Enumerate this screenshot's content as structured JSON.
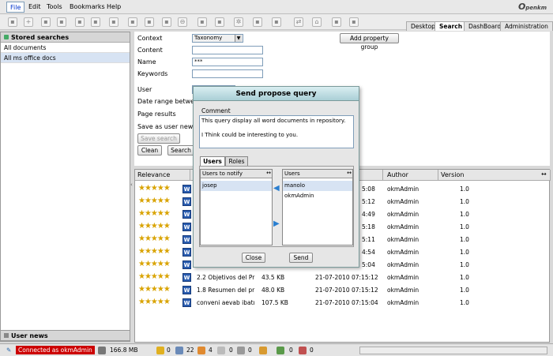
{
  "menu": [
    "File",
    "Edit",
    "Tools",
    "Bookmarks",
    "Help"
  ],
  "logo": {
    "brand": "penkm",
    "glyph": "O"
  },
  "tabs": [
    "Desktop",
    "Search",
    "DashBoard",
    "Administration"
  ],
  "toolbar_icons": [
    "new-folder-icon",
    "add-document-icon",
    "checkout-icon",
    "checkin-icon",
    "cancel-checkout-icon",
    "lock-icon",
    "unlock-icon",
    "delete-icon",
    "copy-icon",
    "move-icon",
    "rename-icon",
    "refresh-icon",
    "settings-icon",
    "scan-icon",
    "export-icon",
    "home-icon"
  ],
  "left": {
    "header": "Stored searches",
    "items": [
      "All documents",
      "All ms office docs"
    ],
    "footer": "User news"
  },
  "form": {
    "labels": [
      "Context",
      "Content",
      "Name",
      "Keywords",
      "User",
      "Date range between",
      "Page results",
      "Save as user news"
    ],
    "context_value": "Taxonomy",
    "name_value": "***",
    "add_property_group": "Add property group",
    "save_search": "Save search",
    "clean": "Clean",
    "search": "Search"
  },
  "results": {
    "headers": [
      "Relevance",
      "Author",
      "Version"
    ],
    "expand": "↔",
    "rows": [
      {
        "name": "",
        "size": "",
        "date_fragment": "5:08",
        "author": "okmAdmin",
        "version": "1.0"
      },
      {
        "name": "",
        "size": "",
        "date_fragment": "5:12",
        "author": "okmAdmin",
        "version": "1.0"
      },
      {
        "name": "",
        "size": "",
        "date_fragment": "4:49",
        "author": "okmAdmin",
        "version": "1.0"
      },
      {
        "name": "",
        "size": "",
        "date_fragment": "5:18",
        "author": "okmAdmin",
        "version": "1.0"
      },
      {
        "name": "",
        "size": "",
        "date_fragment": "5:11",
        "author": "okmAdmin",
        "version": "1.0"
      },
      {
        "name": "",
        "size": "",
        "date_fragment": "4:54",
        "author": "okmAdmin",
        "version": "1.0"
      },
      {
        "name": "",
        "size": "",
        "date_fragment": "5:04",
        "author": "okmAdmin",
        "version": "1.0"
      },
      {
        "name": "2.2 Objetivos del Pr",
        "size": "43.5 KB",
        "date": "21-07-2010 07:15:12",
        "author": "okmAdmin",
        "version": "1.0"
      },
      {
        "name": "1.8 Resumen del pr",
        "size": "48.0 KB",
        "date": "21-07-2010 07:15:12",
        "author": "okmAdmin",
        "version": "1.0"
      },
      {
        "name": "conveni aevab ibatı",
        "size": "107.5 KB",
        "date": "21-07-2010 07:15:04",
        "author": "okmAdmin",
        "version": "1.0"
      }
    ]
  },
  "dialog": {
    "title": "Send propose query",
    "comment_label": "Comment",
    "comment_line1": "This query display all word documents in repository.",
    "comment_line2": "I Think could be interesting to you.",
    "tabs": [
      "Users",
      "Roles"
    ],
    "notify_header": "Users to notify",
    "users_header": "Users",
    "notify_list": [
      "josep"
    ],
    "users_list": [
      "manolo",
      "okmAdmin"
    ],
    "close": "Close",
    "send": "Send"
  },
  "status": {
    "connected": "Connected as okmAdmin",
    "size": "166.8 MB",
    "counts": [
      "0",
      "22",
      "4",
      "0",
      "0",
      "0",
      "0"
    ]
  },
  "colors": {
    "accent": "#cc0000",
    "selection": "#d7e3f3",
    "dialog_title": "#aacfd6"
  }
}
